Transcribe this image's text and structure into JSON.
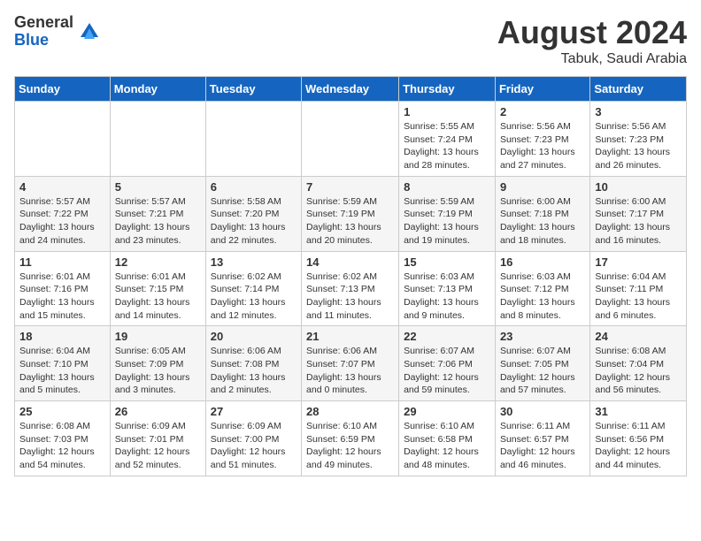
{
  "logo": {
    "general": "General",
    "blue": "Blue"
  },
  "title": {
    "month_year": "August 2024",
    "location": "Tabuk, Saudi Arabia"
  },
  "headers": [
    "Sunday",
    "Monday",
    "Tuesday",
    "Wednesday",
    "Thursday",
    "Friday",
    "Saturday"
  ],
  "weeks": [
    [
      {
        "day": "",
        "content": ""
      },
      {
        "day": "",
        "content": ""
      },
      {
        "day": "",
        "content": ""
      },
      {
        "day": "",
        "content": ""
      },
      {
        "day": "1",
        "content": "Sunrise: 5:55 AM\nSunset: 7:24 PM\nDaylight: 13 hours\nand 28 minutes."
      },
      {
        "day": "2",
        "content": "Sunrise: 5:56 AM\nSunset: 7:23 PM\nDaylight: 13 hours\nand 27 minutes."
      },
      {
        "day": "3",
        "content": "Sunrise: 5:56 AM\nSunset: 7:23 PM\nDaylight: 13 hours\nand 26 minutes."
      }
    ],
    [
      {
        "day": "4",
        "content": "Sunrise: 5:57 AM\nSunset: 7:22 PM\nDaylight: 13 hours\nand 24 minutes."
      },
      {
        "day": "5",
        "content": "Sunrise: 5:57 AM\nSunset: 7:21 PM\nDaylight: 13 hours\nand 23 minutes."
      },
      {
        "day": "6",
        "content": "Sunrise: 5:58 AM\nSunset: 7:20 PM\nDaylight: 13 hours\nand 22 minutes."
      },
      {
        "day": "7",
        "content": "Sunrise: 5:59 AM\nSunset: 7:19 PM\nDaylight: 13 hours\nand 20 minutes."
      },
      {
        "day": "8",
        "content": "Sunrise: 5:59 AM\nSunset: 7:19 PM\nDaylight: 13 hours\nand 19 minutes."
      },
      {
        "day": "9",
        "content": "Sunrise: 6:00 AM\nSunset: 7:18 PM\nDaylight: 13 hours\nand 18 minutes."
      },
      {
        "day": "10",
        "content": "Sunrise: 6:00 AM\nSunset: 7:17 PM\nDaylight: 13 hours\nand 16 minutes."
      }
    ],
    [
      {
        "day": "11",
        "content": "Sunrise: 6:01 AM\nSunset: 7:16 PM\nDaylight: 13 hours\nand 15 minutes."
      },
      {
        "day": "12",
        "content": "Sunrise: 6:01 AM\nSunset: 7:15 PM\nDaylight: 13 hours\nand 14 minutes."
      },
      {
        "day": "13",
        "content": "Sunrise: 6:02 AM\nSunset: 7:14 PM\nDaylight: 13 hours\nand 12 minutes."
      },
      {
        "day": "14",
        "content": "Sunrise: 6:02 AM\nSunset: 7:13 PM\nDaylight: 13 hours\nand 11 minutes."
      },
      {
        "day": "15",
        "content": "Sunrise: 6:03 AM\nSunset: 7:13 PM\nDaylight: 13 hours\nand 9 minutes."
      },
      {
        "day": "16",
        "content": "Sunrise: 6:03 AM\nSunset: 7:12 PM\nDaylight: 13 hours\nand 8 minutes."
      },
      {
        "day": "17",
        "content": "Sunrise: 6:04 AM\nSunset: 7:11 PM\nDaylight: 13 hours\nand 6 minutes."
      }
    ],
    [
      {
        "day": "18",
        "content": "Sunrise: 6:04 AM\nSunset: 7:10 PM\nDaylight: 13 hours\nand 5 minutes."
      },
      {
        "day": "19",
        "content": "Sunrise: 6:05 AM\nSunset: 7:09 PM\nDaylight: 13 hours\nand 3 minutes."
      },
      {
        "day": "20",
        "content": "Sunrise: 6:06 AM\nSunset: 7:08 PM\nDaylight: 13 hours\nand 2 minutes."
      },
      {
        "day": "21",
        "content": "Sunrise: 6:06 AM\nSunset: 7:07 PM\nDaylight: 13 hours\nand 0 minutes."
      },
      {
        "day": "22",
        "content": "Sunrise: 6:07 AM\nSunset: 7:06 PM\nDaylight: 12 hours\nand 59 minutes."
      },
      {
        "day": "23",
        "content": "Sunrise: 6:07 AM\nSunset: 7:05 PM\nDaylight: 12 hours\nand 57 minutes."
      },
      {
        "day": "24",
        "content": "Sunrise: 6:08 AM\nSunset: 7:04 PM\nDaylight: 12 hours\nand 56 minutes."
      }
    ],
    [
      {
        "day": "25",
        "content": "Sunrise: 6:08 AM\nSunset: 7:03 PM\nDaylight: 12 hours\nand 54 minutes."
      },
      {
        "day": "26",
        "content": "Sunrise: 6:09 AM\nSunset: 7:01 PM\nDaylight: 12 hours\nand 52 minutes."
      },
      {
        "day": "27",
        "content": "Sunrise: 6:09 AM\nSunset: 7:00 PM\nDaylight: 12 hours\nand 51 minutes."
      },
      {
        "day": "28",
        "content": "Sunrise: 6:10 AM\nSunset: 6:59 PM\nDaylight: 12 hours\nand 49 minutes."
      },
      {
        "day": "29",
        "content": "Sunrise: 6:10 AM\nSunset: 6:58 PM\nDaylight: 12 hours\nand 48 minutes."
      },
      {
        "day": "30",
        "content": "Sunrise: 6:11 AM\nSunset: 6:57 PM\nDaylight: 12 hours\nand 46 minutes."
      },
      {
        "day": "31",
        "content": "Sunrise: 6:11 AM\nSunset: 6:56 PM\nDaylight: 12 hours\nand 44 minutes."
      }
    ]
  ]
}
